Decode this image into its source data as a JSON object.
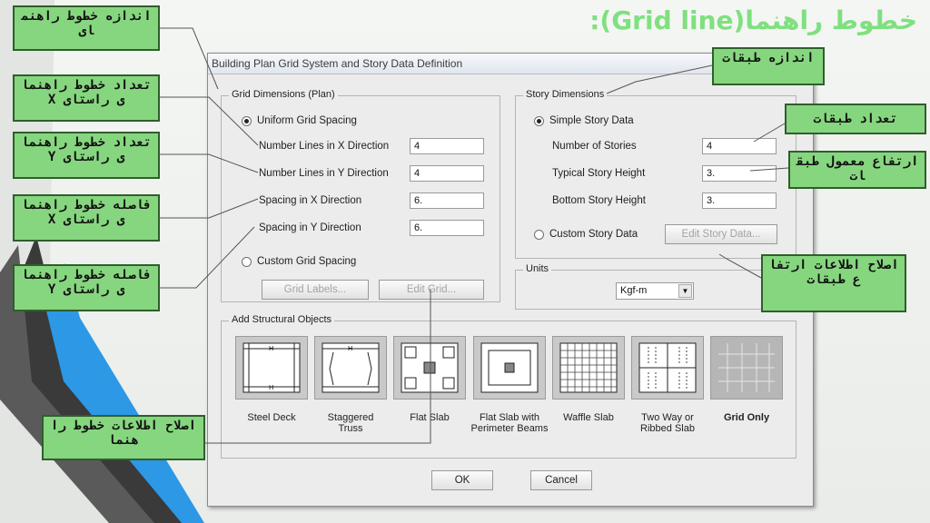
{
  "slide_title": "خطوط راهنما(Grid line):",
  "dialog": {
    "title": "Building Plan Grid System and Story Data Definition",
    "grid": {
      "title": "Grid Dimensions (Plan)",
      "uniform_label": "Uniform Grid Spacing",
      "x_lines_label": "Number Lines in X Direction",
      "x_lines_value": "4",
      "y_lines_label": "Number Lines in Y Direction",
      "y_lines_value": "4",
      "x_spacing_label": "Spacing in X Direction",
      "x_spacing_value": "6.",
      "y_spacing_label": "Spacing in Y Direction",
      "y_spacing_value": "6.",
      "custom_label": "Custom Grid Spacing",
      "grid_labels_button": "Grid Labels...",
      "edit_grid_button": "Edit Grid..."
    },
    "story": {
      "title": "Story Dimensions",
      "simple_label": "Simple Story Data",
      "num_stories_label": "Number of Stories",
      "num_stories_value": "4",
      "typical_label": "Typical Story Height",
      "typical_value": "3.",
      "bottom_label": "Bottom Story Height",
      "bottom_value": "3.",
      "custom_label": "Custom Story Data",
      "edit_story_button": "Edit Story Data..."
    },
    "units": {
      "title": "Units",
      "value": "Kgf-m"
    },
    "structural": {
      "title": "Add Structural Objects",
      "items": [
        {
          "label": "Steel Deck",
          "label2": ""
        },
        {
          "label": "Staggered",
          "label2": "Truss"
        },
        {
          "label": "Flat Slab",
          "label2": ""
        },
        {
          "label": "Flat Slab with",
          "label2": "Perimeter Beams"
        },
        {
          "label": "Waffle Slab",
          "label2": ""
        },
        {
          "label": "Two Way or",
          "label2": "Ribbed Slab"
        },
        {
          "label": "Grid Only",
          "label2": ""
        }
      ]
    },
    "ok_button": "OK",
    "cancel_button": "Cancel"
  },
  "notes": {
    "grid_size": "اندازه خطوط راهنمای",
    "x_count": "تعداد خطوط راهنمای راستای X",
    "y_count": "تعداد خطوط راهنمای راستای Y",
    "x_spacing": "فاصله خطوط راهنمای راستای X",
    "y_spacing": "فاصله خطوط راهنمای راستای Y",
    "story_size": "اندازه طبقات",
    "num_stories": "تعداد طبقات",
    "typical_height": "ارتفاع معمول طبقات",
    "edit_story": "اصلاح اطلاعات ارتفاع طبقات",
    "edit_grid": "اصلاح اطلاعات خطوط راهنما"
  },
  "colors": {
    "accent_green": "#86d67f",
    "title_green": "#7fe07f",
    "stripe_dark": "#3a3a3a",
    "stripe_blue": "#2c98e6"
  }
}
